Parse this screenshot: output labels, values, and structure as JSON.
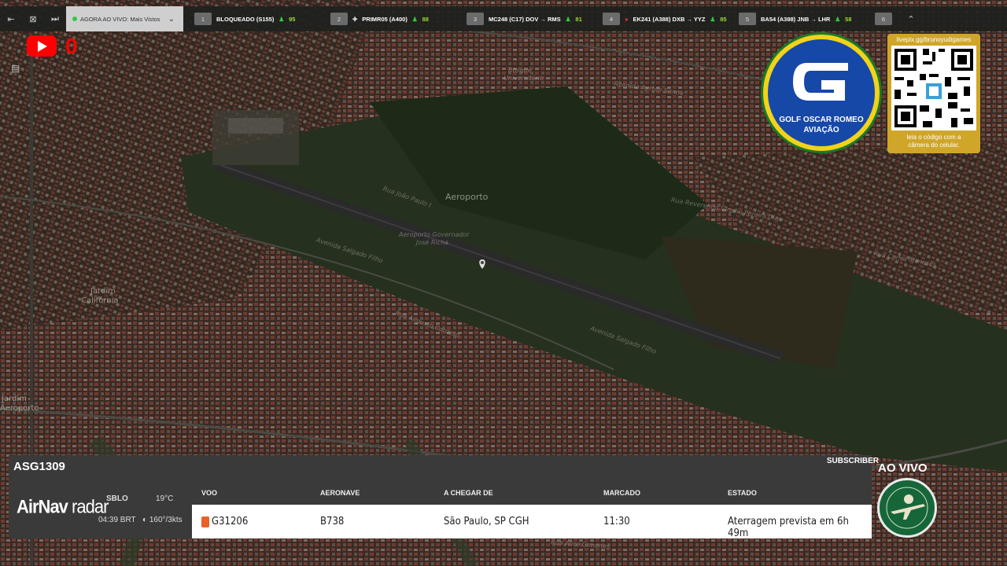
{
  "topbar": {
    "live_tab_label": "AGORA AO VIVO: Mais Vistos",
    "flight_tabs": [
      {
        "num": "1",
        "label": "BLOQUEADO (S155)",
        "score": "95"
      },
      {
        "num": "2",
        "label": "PRIMR05 (A400)",
        "score": "88"
      },
      {
        "num": "3",
        "label": "MC248 (C17)  DOV → RMS",
        "score": "81"
      },
      {
        "num": "4",
        "label": "EK241 (A388)  DXB → YYZ",
        "score": "85"
      },
      {
        "num": "5",
        "label": "BA54 (A388)  JNB → LHR",
        "score": "58"
      },
      {
        "num": "6",
        "label": "",
        "score": ""
      }
    ]
  },
  "youtube": {
    "count": "0"
  },
  "map_labels": {
    "aeroporto": "Aeroporto",
    "airport_name_1": "Aeroporto Governador",
    "airport_name_2": "José Richa",
    "jardim_1": "Jardim",
    "jardim_2": "Califórnia",
    "left_1": "Jardim",
    "left_2": "Aeroporto",
    "street_1": "Rua João Paulo I",
    "street_2": "Avenida Salgado Filho",
    "street_3": "Rua Augusto Cardoso",
    "street_4": "Avenida Salgado Filho",
    "street_5": "Rua Reverendo Virgílio Pereira Dias",
    "street_6": "Rua Carlos Meneses",
    "universidade_1": "Bosque",
    "universidade_2": "Universitário",
    "street_7": "Avenida Ayrton Senna",
    "street_8": "Rua Alice Gimenes"
  },
  "logo": {
    "line1": "GOLF OSCAR ROMEO",
    "line2": "AVIAÇÃO"
  },
  "qr": {
    "url": "livepix.gg/brunoyudigames",
    "caption_1": "leia o código com a",
    "caption_2": "câmera do celular."
  },
  "panel": {
    "callsign": "ASG1309",
    "subscriber": "SUBSCRIBER",
    "brand_air": "AirNav",
    "brand_radar": " radar",
    "airport_code": "SBLO",
    "local_time": "04:39 BRT",
    "temperature": "19°C",
    "wind": "160°/3kts",
    "columns": [
      "VOO",
      "AERONAVE",
      "A CHEGAR DE",
      "MARCADO",
      "ESTADO"
    ],
    "row": {
      "flight": "G31206",
      "aircraft": "B738",
      "origin": "São Paulo, SP CGH",
      "scheduled": "11:30",
      "status": "Aterragem prevista em 6h 49m"
    }
  },
  "live_label": "AO VIVO",
  "colors": {
    "panel_bg": "#3a3a3a",
    "live_dot": "#2ecc40",
    "score_green": "#9ddc32",
    "yt_red": "#ff0000",
    "logo_blue": "#1648a8",
    "logo_yellow": "#f2d21a"
  }
}
